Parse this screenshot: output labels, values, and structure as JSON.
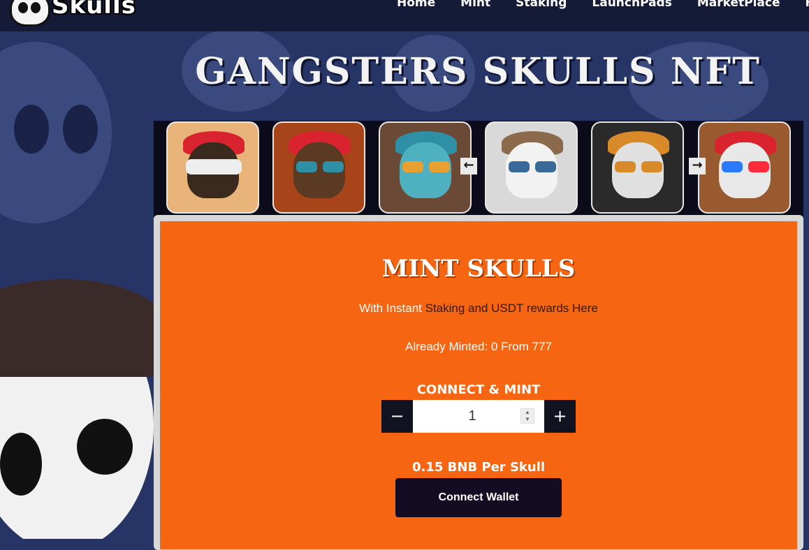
{
  "brand": {
    "logo_text": "Skulls"
  },
  "nav": [
    "Home",
    "Mint",
    "Staking",
    "LaunchPads",
    "MarketPlace",
    "Ho"
  ],
  "hero_title": "GANGSTERS SKULLS NFT",
  "carousel": {
    "prev_icon": "arrow-left-icon",
    "next_icon": "arrow-right-icon",
    "prev_glyph": "←",
    "next_glyph": "→",
    "cards": [
      {
        "name": "skull-bandana-shutter",
        "bg": "#e8b47a",
        "accent": "#d9232e"
      },
      {
        "name": "skull-bandana-axe",
        "bg": "#a8441a",
        "accent": "#d9232e"
      },
      {
        "name": "skull-beanie-bitcoin",
        "bg": "#6a4a36",
        "accent": "#2f8fa4"
      },
      {
        "name": "skull-bucket-marble",
        "bg": "#d9d9d9",
        "accent": "#3a6a9a"
      },
      {
        "name": "skull-orange-eyes",
        "bg": "#2a2a2a",
        "accent": "#d98a28"
      },
      {
        "name": "skull-bandana-3d",
        "bg": "#9a5a30",
        "accent": "#d9232e"
      }
    ]
  },
  "mint": {
    "title": "MINT SKULLS",
    "subtitle_a": "With Instant ",
    "subtitle_b": "Staking and USDT rewards Here",
    "minted_text": "Already Minted: 0 From 777",
    "connect_mint_label": "CONNECT & MINT",
    "minus": "−",
    "plus": "+",
    "quantity": "1",
    "price": "0.15 BNB Per Skull",
    "wallet_button": "Connect Wallet"
  },
  "colors": {
    "accent": "#f66511",
    "header": "#151a36",
    "background": "#273566"
  }
}
